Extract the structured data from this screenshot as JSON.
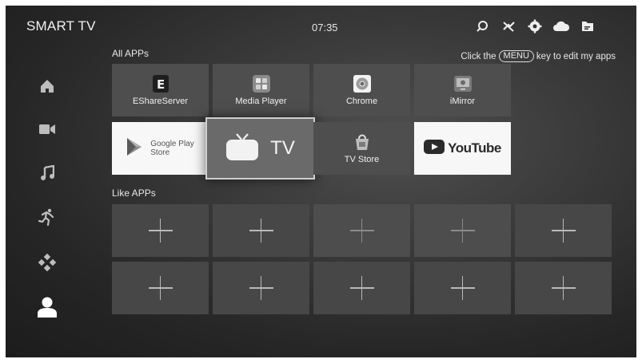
{
  "header": {
    "brand": "SMART TV",
    "time": "07:35",
    "icons": [
      "search-icon",
      "no-signal-icon",
      "gear-icon",
      "cloud-icon",
      "folder-icon"
    ]
  },
  "sidebar": {
    "items": [
      {
        "icon": "home-icon"
      },
      {
        "icon": "video-icon"
      },
      {
        "icon": "music-icon"
      },
      {
        "icon": "running-icon"
      },
      {
        "icon": "apps-diamond-icon"
      },
      {
        "icon": "user-icon",
        "active": true
      }
    ]
  },
  "all_apps": {
    "title": "All APPs",
    "hint_prefix": "Click the",
    "hint_key": "MENU",
    "hint_suffix": "key to edit my apps",
    "apps": [
      {
        "label": "EShareServer",
        "icon": "eshare-icon"
      },
      {
        "label": "Media Player",
        "icon": "media-player-icon"
      },
      {
        "label": "Chrome",
        "icon": "chrome-icon"
      },
      {
        "label": "iMirror",
        "icon": "imirror-icon"
      },
      {
        "label": "Google Play\nStore",
        "line1": "Google Play",
        "line2": "Store",
        "icon": "google-play-icon"
      },
      {
        "label": "TV",
        "icon": "tv-icon",
        "focused": true
      },
      {
        "label": "TV Store",
        "icon": "tv-store-icon"
      },
      {
        "label": "YouTube",
        "icon": "youtube-icon"
      }
    ]
  },
  "like_apps": {
    "title": "Like APPs",
    "slots": 10
  },
  "colors": {
    "background": "#2a2a2a",
    "tile": "#4e4e4e",
    "focus_border": "#cfcfcf"
  }
}
